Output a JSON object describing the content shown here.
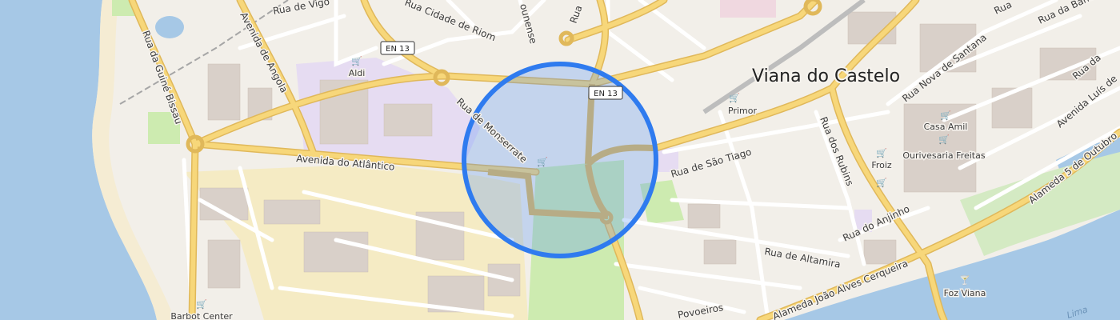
{
  "map": {
    "city_label": "Viana do Castelo",
    "road_shields": [
      {
        "id": "en13-a",
        "text": "EN 13"
      },
      {
        "id": "en13-b",
        "text": "EN 13"
      }
    ],
    "streets": {
      "rua_de_vigo": "Rua de Vigo",
      "avenida_de_angola": "Avenida de Angola",
      "rua_da_guine_bissau": "Rua da Guiné Bissau",
      "avenida_do_atlantico": "Avenida do Atlântico",
      "rua_de_monserrate": "Rua de Monserrate",
      "cidade_de_riom": "Rua Cidade de Riom",
      "rua_de_sao_tiago": "Rua de São Tiago",
      "rua_dos_rubins": "Rua dos Rubins",
      "rua_nova_de_santana": "Rua Nova de Santana",
      "rua_da_bandeira": "Rua da Bandeira",
      "rua_do_anjinho": "Rua do Anjinho",
      "rua_de_altamira": "Rua de Altamira",
      "alameda_joao_alves_cerqueira": "Alameda João Alves Cerqueira",
      "alameda_5_de_outubro": "Alameda 5 de Outubro",
      "avenida_luis": "Avenida Luís de",
      "povoeiros": "Povoeiros",
      "top_partial_1": "Rua",
      "top_partial_2": "Rua",
      "top_partial_3": "Rua da",
      "ounense": "ounense"
    },
    "pois": [
      {
        "id": "aldi",
        "label": "Aldi",
        "icon": "shop-icon"
      },
      {
        "id": "primor",
        "label": "Primor",
        "icon": "shop-icon"
      },
      {
        "id": "casa-amil",
        "label": "Casa Amil",
        "icon": "shop-icon"
      },
      {
        "id": "ourivesaria-freitas",
        "label": "Ourivesaria Freitas",
        "icon": "shop-icon"
      },
      {
        "id": "froiz",
        "label": "Froiz",
        "icon": "shop-icon"
      },
      {
        "id": "foz-viana",
        "label": "Foz Viana",
        "icon": "cocktail-icon"
      },
      {
        "id": "barbot-center",
        "label": "Barbot Center",
        "icon": "shop-icon"
      }
    ],
    "water_label": "Lima",
    "colors": {
      "land": "#f2efe9",
      "water": "#aad3df",
      "sea": "#a6c8e6",
      "road_major": "#f7d77a",
      "road_major_casing": "#e0b85a",
      "road_minor": "#ffffff",
      "industrial": "#f5ebc4",
      "education": "#e6dcf2",
      "park": "#cdebb0",
      "building": "#d9d0c9",
      "accuracy_fill": "#4f8ef7",
      "accuracy_ring": "#2f7bef"
    }
  }
}
